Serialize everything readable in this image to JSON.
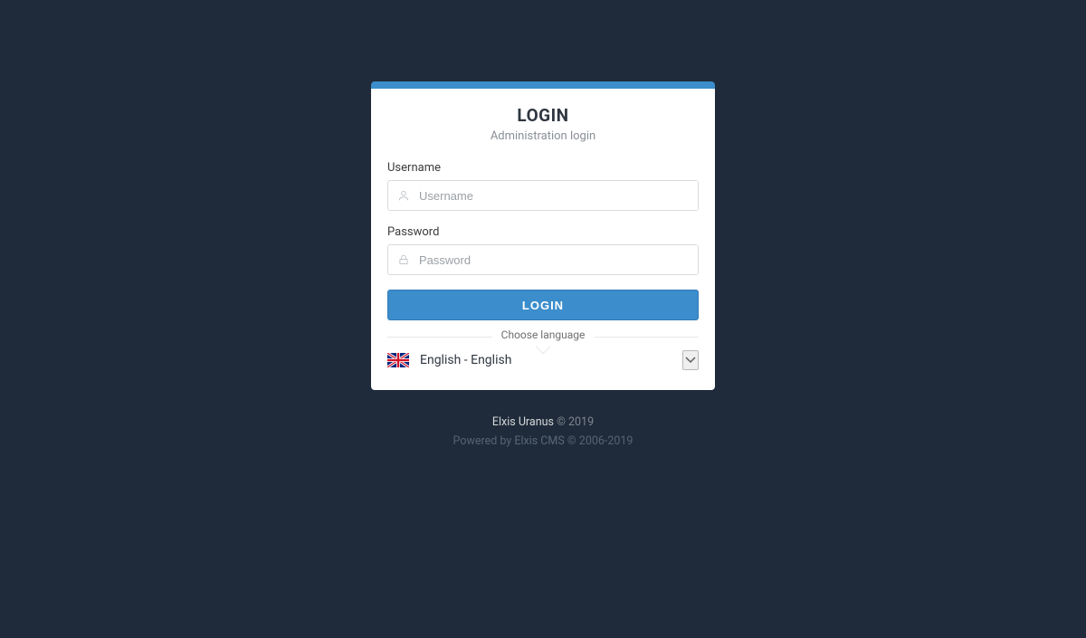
{
  "panel": {
    "title": "LOGIN",
    "subtitle": "Administration login",
    "username_label": "Username",
    "username_placeholder": "Username",
    "password_label": "Password",
    "password_placeholder": "Password",
    "login_button": "LOGIN",
    "choose_language": "Choose language",
    "selected_language": "English - English"
  },
  "footer": {
    "brand": "Elxis Uranus",
    "copyright_year": " © 2019",
    "powered_prefix": "Powered by ",
    "powered_link": "Elxis CMS",
    "powered_suffix": " © 2006-2019"
  },
  "colors": {
    "accent": "#3b8dcc",
    "bg": "#1f2b3a"
  }
}
